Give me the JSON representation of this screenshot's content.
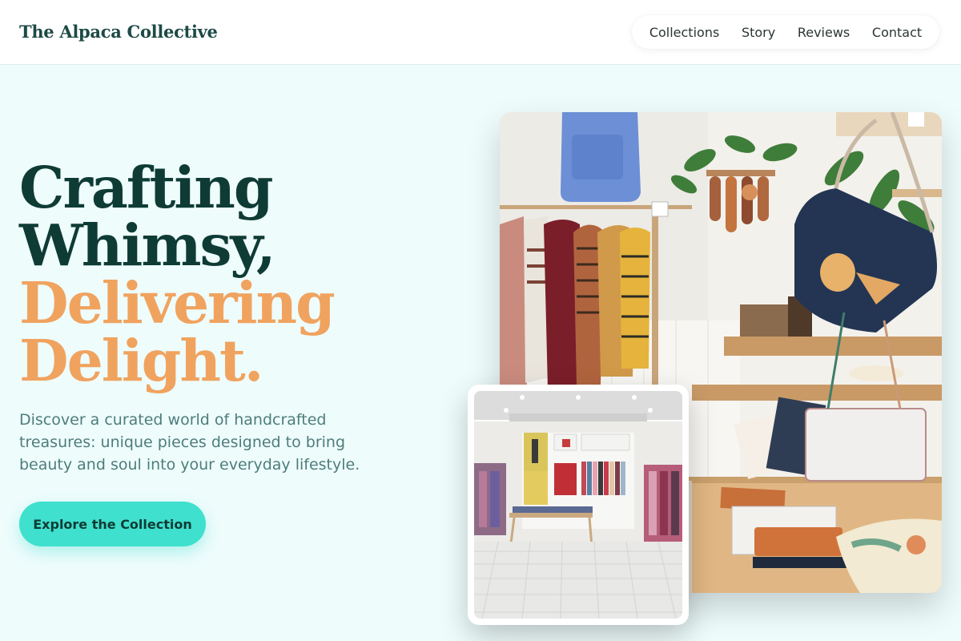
{
  "brand": {
    "name": "The Alpaca Collective"
  },
  "nav": {
    "items": [
      {
        "label": "Collections"
      },
      {
        "label": "Story"
      },
      {
        "label": "Reviews"
      },
      {
        "label": "Contact"
      }
    ]
  },
  "hero": {
    "headline_line1": "Crafting",
    "headline_line2": "Whimsy,",
    "headline_line3": "Delivering",
    "headline_line4": "Delight.",
    "subtext": "Discover a curated world of handcrafted treasures: unique pieces designed to bring beauty and soul into your everyday lifestyle.",
    "cta_label": "Explore the Collection"
  },
  "colors": {
    "page_background": "#eefcfc",
    "headline_dark": "#0f3b35",
    "headline_accent": "#f0a35f",
    "cta_background": "#3fe0cd",
    "body_text": "#4d7d7a"
  },
  "images": {
    "main": "boutique-interior-photo",
    "inset": "clothing-store-photo"
  }
}
